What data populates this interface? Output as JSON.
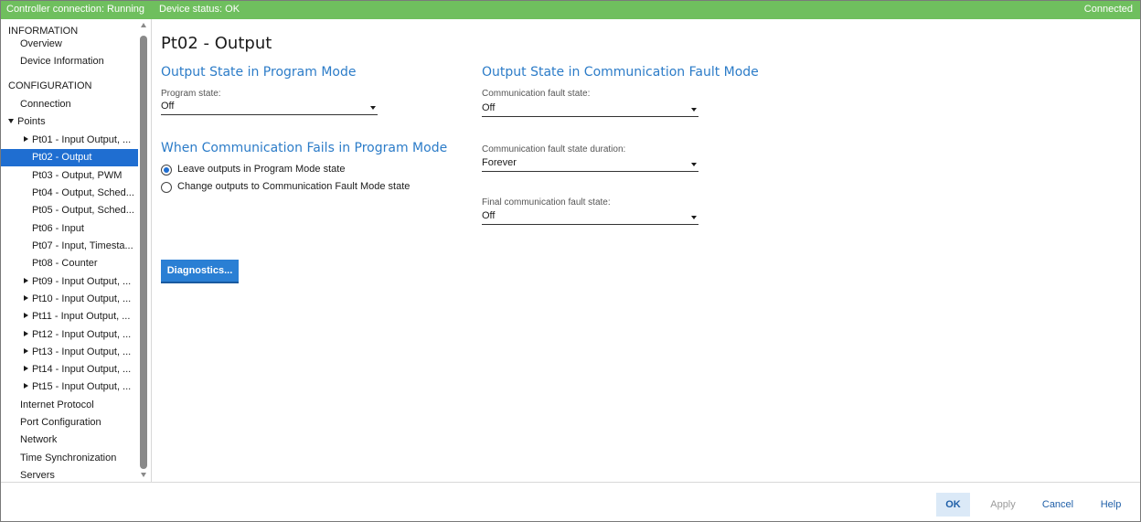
{
  "status_bar": {
    "controller_connection": "Controller connection: Running",
    "device_status": "Device status: OK",
    "connected": "Connected",
    "color": "#6fbf5e"
  },
  "sidebar": {
    "items": [
      {
        "label": "INFORMATION",
        "header": true
      },
      {
        "label": "Overview"
      },
      {
        "label": "Device Information"
      },
      {
        "label": "CONFIGURATION",
        "header": true
      },
      {
        "label": "Connection"
      },
      {
        "label": "Points",
        "expander": "down"
      },
      {
        "label": "Pt01 - Input Output, ...",
        "expander": "right"
      },
      {
        "label": "Pt02 - Output",
        "selected": true
      },
      {
        "label": "Pt03 - Output, PWM"
      },
      {
        "label": "Pt04 - Output, Sched..."
      },
      {
        "label": "Pt05 - Output, Sched..."
      },
      {
        "label": "Pt06 - Input"
      },
      {
        "label": "Pt07 - Input, Timesta..."
      },
      {
        "label": "Pt08 - Counter"
      },
      {
        "label": "Pt09 - Input Output, ...",
        "expander": "right"
      },
      {
        "label": "Pt10 - Input Output, ...",
        "expander": "right"
      },
      {
        "label": "Pt11 - Input Output, ...",
        "expander": "right"
      },
      {
        "label": "Pt12 - Input Output, ...",
        "expander": "right"
      },
      {
        "label": "Pt13 - Input Output, ...",
        "expander": "right"
      },
      {
        "label": "Pt14 - Input Output, ...",
        "expander": "right"
      },
      {
        "label": "Pt15 - Input Output, ...",
        "expander": "right"
      },
      {
        "label": "Internet Protocol"
      },
      {
        "label": "Port Configuration"
      },
      {
        "label": "Network"
      },
      {
        "label": "Time Synchronization"
      },
      {
        "label": "Servers"
      }
    ],
    "selected_color": "#1f6ed1"
  },
  "main": {
    "title": "Pt02 - Output",
    "program_mode": {
      "section_title": "Output State in Program Mode",
      "program_state_label": "Program state:",
      "program_state_value": "Off"
    },
    "comm_fails": {
      "section_title": "When Communication Fails in Program Mode",
      "option_leave": "Leave outputs in Program Mode state",
      "option_change": "Change outputs to Communication Fault Mode state",
      "selected": "leave"
    },
    "fault_mode": {
      "section_title": "Output State in Communication Fault Mode",
      "fault_state_label": "Communication fault state:",
      "fault_state_value": "Off",
      "duration_label": "Communication fault state duration:",
      "duration_value": "Forever",
      "final_label": "Final communication fault state:",
      "final_value": "Off"
    },
    "diagnostics_button": "Diagnostics...",
    "accent_color": "#2c7cc8"
  },
  "footer": {
    "ok": "OK",
    "apply": "Apply",
    "cancel": "Cancel",
    "help": "Help"
  }
}
